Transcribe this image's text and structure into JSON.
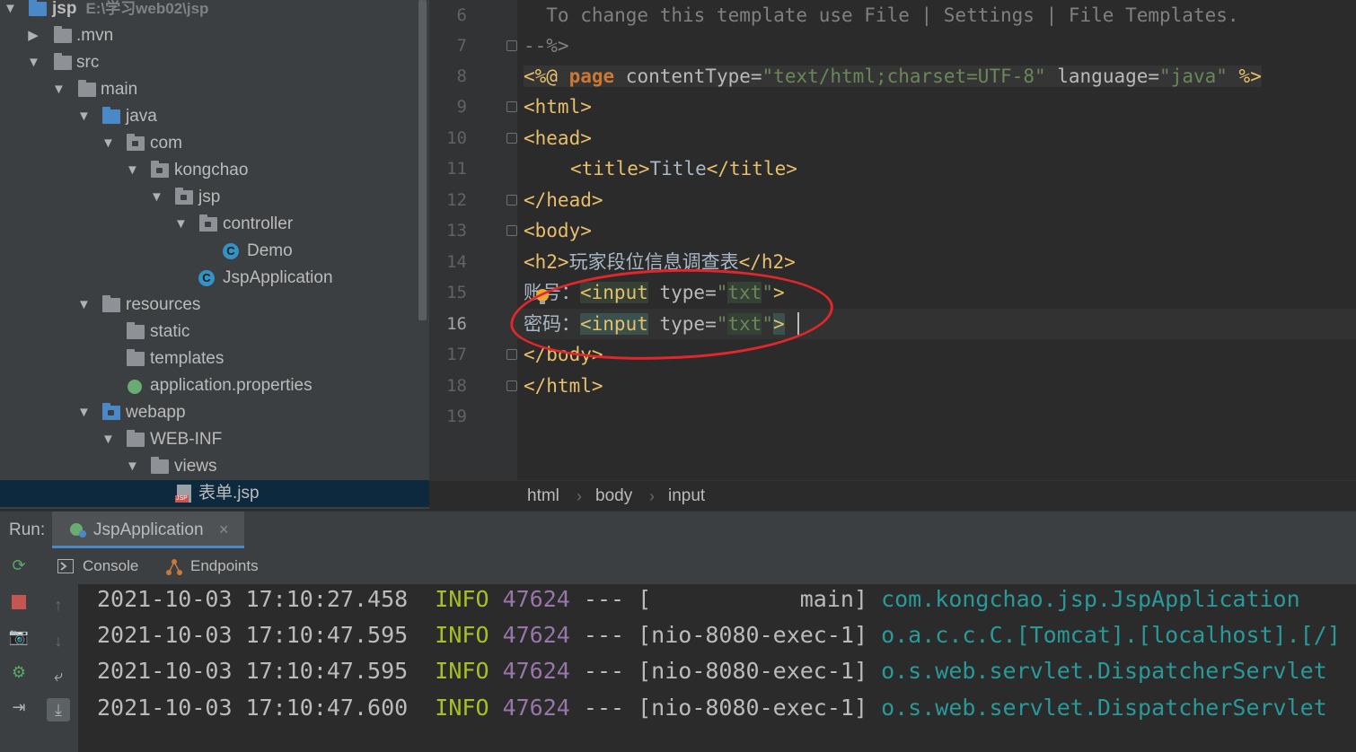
{
  "tree": {
    "root_name": "jsp",
    "root_path": "E:\\学习web02\\jsp",
    "items": [
      {
        "label": ".mvn",
        "icon": "folder-icon"
      },
      {
        "label": "src",
        "icon": "folder-icon"
      },
      {
        "label": "main",
        "icon": "folder-icon"
      },
      {
        "label": "java",
        "icon": "source-folder-icon"
      },
      {
        "label": "com",
        "icon": "package-icon"
      },
      {
        "label": "kongchao",
        "icon": "package-icon"
      },
      {
        "label": "jsp",
        "icon": "package-icon"
      },
      {
        "label": "controller",
        "icon": "package-icon"
      },
      {
        "label": "Demo",
        "icon": "class-icon"
      },
      {
        "label": "JspApplication",
        "icon": "spring-boot-class-icon"
      },
      {
        "label": "resources",
        "icon": "resources-folder-icon"
      },
      {
        "label": "static",
        "icon": "folder-icon"
      },
      {
        "label": "templates",
        "icon": "folder-icon"
      },
      {
        "label": "application.properties",
        "icon": "spring-properties-icon"
      },
      {
        "label": "webapp",
        "icon": "web-folder-icon"
      },
      {
        "label": "WEB-INF",
        "icon": "folder-icon"
      },
      {
        "label": "views",
        "icon": "folder-icon"
      },
      {
        "label": "表单.jsp",
        "icon": "jsp-file-icon"
      }
    ]
  },
  "editor": {
    "line_numbers": [
      "6",
      "7",
      "8",
      "9",
      "10",
      "11",
      "12",
      "13",
      "14",
      "15",
      "16",
      "17",
      "18",
      "19"
    ],
    "current_line": "16",
    "lines": {
      "l6": "  To change this template use File | Settings | File Templates.",
      "l7": "--%>",
      "l8_open": "<%@ ",
      "l8_kw": "page",
      "l8_a1": " contentType=",
      "l8_v1": "\"text/html;charset=UTF-8\"",
      "l8_a2": " language=",
      "l8_v2": "\"java\"",
      "l8_close": " %>",
      "l9": "<html>",
      "l10": "<head>",
      "l11_open": "<title>",
      "l11_text": "Title",
      "l11_close": "</title>",
      "l12": "</head>",
      "l13": "<body>",
      "l14_open": "<h2>",
      "l14_text": "玩家段位信息调查表",
      "l14_close": "</h2>",
      "l15_text": "账号：",
      "l15_tag": "<input",
      "l15_attr": " type=",
      "l15_val_q1": "\"",
      "l15_val": "txt",
      "l15_val_q2": "\"",
      "l15_end": ">",
      "l16_text": "密码：",
      "l16_tag": "<input",
      "l16_attr": " type=",
      "l16_val_q1": "\"",
      "l16_val": "txt",
      "l16_val_q2": "\"",
      "l16_end": ">",
      "l17": "</body>",
      "l18": "</html>"
    },
    "breadcrumbs": [
      "html",
      "body",
      "input"
    ]
  },
  "run": {
    "label": "Run:",
    "tab_name": "JspApplication",
    "tab_close": "×",
    "subtabs": [
      "Console",
      "Endpoints"
    ],
    "log": [
      {
        "ts": "2021-10-03 17:10:27.458",
        "level": "INFO",
        "pid": "47624",
        "sep": "---",
        "thread": "[           main]",
        "logger": "com.kongchao.jsp.JspApplication"
      },
      {
        "ts": "2021-10-03 17:10:47.595",
        "level": "INFO",
        "pid": "47624",
        "sep": "---",
        "thread": "[nio-8080-exec-1]",
        "logger": "o.a.c.c.C.[Tomcat].[localhost].[/]"
      },
      {
        "ts": "2021-10-03 17:10:47.595",
        "level": "INFO",
        "pid": "47624",
        "sep": "---",
        "thread": "[nio-8080-exec-1]",
        "logger": "o.s.web.servlet.DispatcherServlet"
      },
      {
        "ts": "2021-10-03 17:10:47.600",
        "level": "INFO",
        "pid": "47624",
        "sep": "---",
        "thread": "[nio-8080-exec-1]",
        "logger": "o.s.web.servlet.DispatcherServlet"
      }
    ]
  },
  "colors": {
    "annotation_circle": "#e3262b",
    "selection": "#0d293e"
  }
}
